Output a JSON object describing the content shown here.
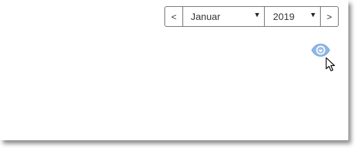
{
  "date_nav": {
    "prev_label": "<",
    "next_label": ">",
    "month": "Januar",
    "year": "2019"
  },
  "colors": {
    "eye_icon": "#8fb7e6",
    "border": "#6c6c6c"
  },
  "icons": {
    "view": "eye-icon",
    "pointer": "mouse-cursor-icon"
  }
}
